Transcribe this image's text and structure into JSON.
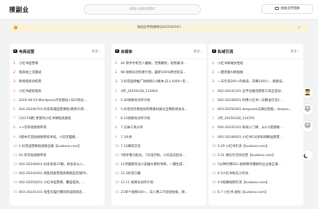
{
  "header": {
    "logo": "搜副业",
    "search_placeholder": "请输入搜索关键词",
    "group_button": "进副业传授群"
  },
  "notice": {
    "text": "进副业传授群微信850585561",
    "close": "×"
  },
  "columns": [
    {
      "title": "电商运营",
      "more": "更多 ›",
      "items": [
        {
          "n": "1",
          "t": "小红书运营课"
        },
        {
          "n": "2",
          "t": "电商线上流量班"
        },
        {
          "n": "3",
          "t": "跨境电商训练营"
        },
        {
          "n": "4",
          "t": "小红书虚拟电商"
        },
        {
          "n": "5",
          "t": "2024-08-01-Wordpress外贸建站+SEO优化..."
        },
        {
          "n": "6",
          "t": "034-20240703-抖音商城运营课程(更新25年..."
        },
        {
          "n": "7",
          "t": "[10170期] 更受热小红书课程高级班"
        },
        {
          "n": "8",
          "t": "××京东短视频带货"
        },
        {
          "n": "9",
          "t": "0基本打造短视频新技术班，小白无脑搬..."
        },
        {
          "n": "10",
          "t": "1.抖音运营教程视频全集【kuakeso.com】"
        },
        {
          "n": "11",
          "t": "01.京东短视频带货"
        },
        {
          "n": "12",
          "t": "002-20240601-抖多多第37期，拼多多从入..."
        },
        {
          "n": "13",
          "t": "002-20241001-闲鱼同类营电商网络店店铺TK..."
        },
        {
          "n": "14",
          "t": "002-20250201-小红书运营课，覆盖电商，..."
        },
        {
          "n": "15",
          "t": "003-20241101-淘宝天猫打爆玩新说同款店..."
        }
      ]
    },
    {
      "title": "自媒体",
      "more": "更多 ›",
      "items": [
        {
          "n": "1",
          "t": "44 快手手机无人播剧，无需硬装，轻松解决..."
        },
        {
          "n": "2",
          "t": "98 视频号创作者计划，最新100%原创玩法..."
        },
        {
          "n": "3",
          "t": "3.抖音品牌推广短视频3.0版本,日入1000+无..."
        },
        {
          "n": "4",
          "t": "3月_20250328_133404"
        },
        {
          "n": "5",
          "t": "5.30视频号创作计划"
        },
        {
          "n": "6",
          "t": "5.抖音创作者给如何用素材美化全网影视会员..."
        },
        {
          "n": "7",
          "t": "6.15视频号创作计划"
        },
        {
          "n": "8",
          "t": "7.记录工具分享"
        },
        {
          "n": "9",
          "t": "7.3头条"
        },
        {
          "n": "10",
          "t": "7.12赚车交流"
        },
        {
          "n": "11",
          "t": "7快手暴力起号，7天涨万粉，小白当天起号..."
        },
        {
          "n": "12",
          "t": "11月最新玩法小说推文暴利项目，一键生成..."
        },
        {
          "n": "13",
          "t": "12.3抖音口播"
        },
        {
          "n": "14",
          "t": "12.11 视频号创作计划"
        },
        {
          "n": "15",
          "t": "21单个视频500+，日入两三千轻轻松松，教..."
        }
      ]
    },
    {
      "title": "私域引流",
      "more": "更多 ›",
      "items": [
        {
          "n": "1",
          "t": "小红书高端女性班"
        },
        {
          "n": "2",
          "t": "一键克隆AI终极版"
        },
        {
          "n": "3",
          "t": "一天引流200+的秘诀，日赚1000+，随意设..."
        },
        {
          "n": "4",
          "t": "002-20241101-全平台截流获客工具全自动..."
        },
        {
          "n": "5",
          "t": "002-20240601-利用小红书一天精准引流1..."
        },
        {
          "n": "6",
          "t": "003-20250301-deepseek与微信智能，deepse..."
        },
        {
          "n": "7",
          "t": "3月_20250328_134705"
        },
        {
          "n": "8",
          "t": "004-20241201-私域入门课，从0-1搭建微..."
        },
        {
          "n": "9",
          "t": "005-20240601-小红书1对多私域精准获客..."
        },
        {
          "n": "10",
          "t": "5.29 小红书引流【kuakeso.com】"
        },
        {
          "n": "11",
          "t": "5.31 微信引流优化营【kuakeso.com】"
        },
        {
          "n": "12",
          "t": "5分钟利用SD+视频制作爆款的企业真正来..."
        },
        {
          "n": "13",
          "t": "6.5小红书私信小作坊"
        },
        {
          "n": "14",
          "t": "6.6招募视频引流【kuakeso.com】"
        },
        {
          "n": "15",
          "t": "6.7 小红书 虚拟【kuakeso.com】"
        }
      ]
    }
  ],
  "side_buttons": [
    "👨‍🎓",
    "🐱",
    "🐱"
  ]
}
